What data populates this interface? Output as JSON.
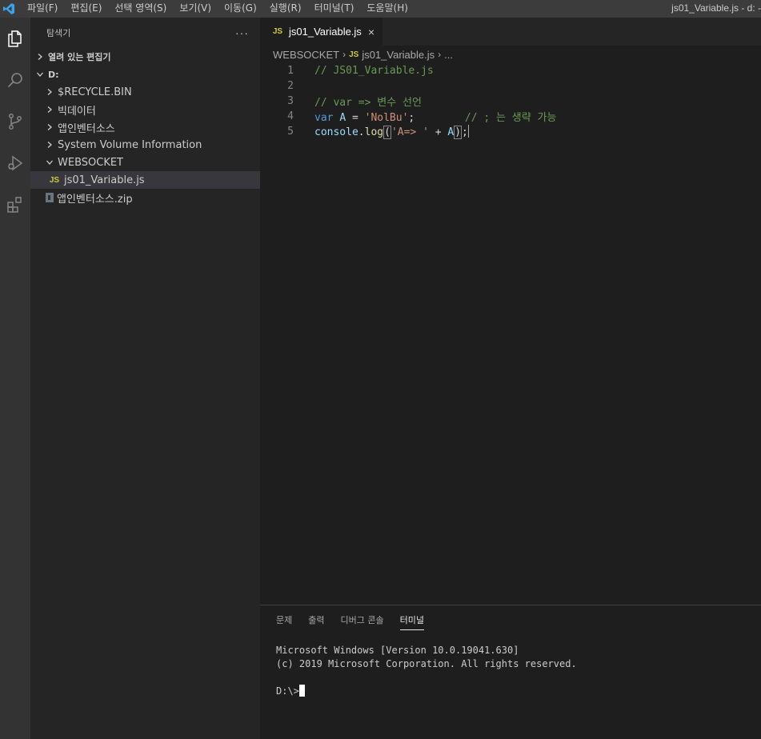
{
  "menubar": {
    "items": [
      "파일(F)",
      "편집(E)",
      "선택 영역(S)",
      "보기(V)",
      "이동(G)",
      "실행(R)",
      "터미널(T)",
      "도움말(H)"
    ],
    "window_title": "js01_Variable.js - d: -"
  },
  "activitybar": {
    "icons": [
      "explorer-icon",
      "search-icon",
      "source-control-icon",
      "run-debug-icon",
      "extensions-icon"
    ]
  },
  "sidebar": {
    "title": "탐색기",
    "more": "···",
    "open_editors": "열려 있는 편집기",
    "root": "D:",
    "items": [
      {
        "label": "$RECYCLE.BIN"
      },
      {
        "label": "빅데이터"
      },
      {
        "label": "앱인벤터소스"
      },
      {
        "label": "System Volume Information"
      },
      {
        "label": "WEBSOCKET"
      },
      {
        "label": "js01_Variable.js"
      },
      {
        "label": "앱인벤터소스.zip"
      }
    ],
    "js_badge": "JS"
  },
  "editor": {
    "tab_label": "js01_Variable.js",
    "tab_close": "×",
    "breadcrumb": {
      "folder": "WEBSOCKET",
      "file": "js01_Variable.js",
      "more": "..."
    },
    "lines": {
      "n1": "1",
      "n2": "2",
      "n3": "3",
      "n4": "4",
      "n5": "5",
      "l1_comment": "// JS01_Variable.js",
      "l3_comment": "// var => 변수 선언",
      "l4_var": "var",
      "l4_name": "A",
      "l4_eq": " = ",
      "l4_str": "'NolBu'",
      "l4_semi": ";",
      "l4_comment": "// ; 는 생략 가능",
      "l5_obj": "console",
      "l5_dot": ".",
      "l5_fn": "log",
      "l5_open": "(",
      "l5_str": "'A=> '",
      "l5_plus": " + ",
      "l5_arg": "A",
      "l5_close": ")",
      "l5_semi": ";"
    }
  },
  "panel": {
    "tabs": [
      "문제",
      "출력",
      "디버그 콘솔",
      "터미널"
    ],
    "active_tab": "터미널",
    "terminal": {
      "line1": "Microsoft Windows [Version 10.0.19041.630]",
      "line2": "(c) 2019 Microsoft Corporation. All rights reserved.",
      "prompt": "D:\\>"
    }
  },
  "colors": {
    "accent": "#007acc",
    "js_badge": "#cbcb41",
    "comment": "#6a9955",
    "keyword": "#569cd6",
    "string": "#ce9178"
  }
}
